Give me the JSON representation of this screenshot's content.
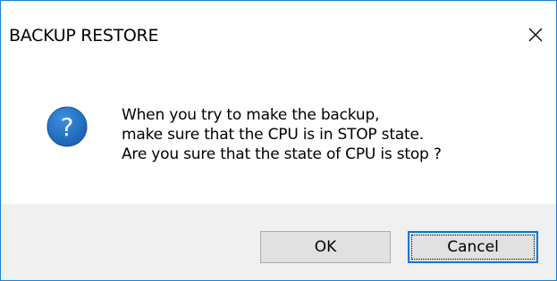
{
  "window": {
    "title": "BACKUP RESTORE",
    "close_symbol": "✕",
    "close_icon": "close-icon"
  },
  "message": {
    "icon": "question-icon",
    "icon_glyph": "?",
    "icon_color": "#1f6fc4",
    "lines": [
      "When you try to make the backup,",
      "make sure that the CPU is in STOP state.",
      "Are you sure that the state of CPU is stop ?"
    ]
  },
  "buttons": {
    "ok_label": "OK",
    "cancel_label": "Cancel",
    "default_button": "Cancel"
  },
  "colors": {
    "window_border": "#1883d7",
    "footer_background": "#f0f0f0",
    "button_face": "#e1e1e1",
    "focus_border": "#0078d7"
  }
}
